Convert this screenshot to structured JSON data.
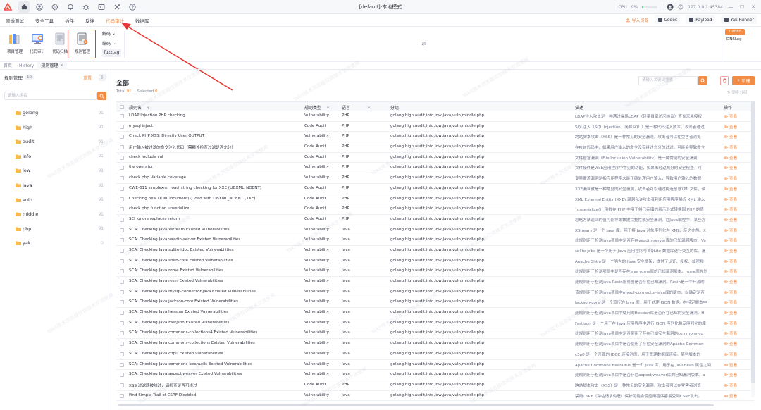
{
  "titlebar": {
    "title": "[default]-本地模式",
    "cpu_label": "CPU",
    "cpu_value": "9%",
    "cpu_fraction": 0.09,
    "engine": "127.0.0.1:45384",
    "icons": [
      "yakit-logo-icon",
      "home-icon",
      "user-icon",
      "gear-icon",
      "bell-icon",
      "bug-icon",
      "terminal-icon",
      "tools-icon",
      "help-icon"
    ]
  },
  "menu": {
    "items": [
      "渗透测试",
      "安全工具",
      "插件",
      "反连",
      "代码审计",
      "数据库"
    ],
    "active_index": 4,
    "import_label": "导入资源",
    "codec_label": "Codec",
    "payload_label": "Payload",
    "runner_label": "Yak Runner"
  },
  "ribbon": {
    "buttons": [
      "项目管理",
      "代码审计",
      "代码扫描",
      "规则管理"
    ],
    "decode_label": "解码",
    "encode_label": "编码",
    "fuzztag_label": "fuzztag",
    "codec_label": "Codec",
    "dnslog_label": "DNSLog"
  },
  "tabs": {
    "items": [
      "首页",
      "History",
      "规则管理"
    ],
    "active_index": 2
  },
  "left": {
    "title": "规则管理",
    "count": "10",
    "reset_label": "重置",
    "search_placeholder": "请输入组名",
    "groups": [
      {
        "name": "golang",
        "count": "91"
      },
      {
        "name": "high",
        "count": "91"
      },
      {
        "name": "audit",
        "count": "91"
      },
      {
        "name": "info",
        "count": "91"
      },
      {
        "name": "low",
        "count": "91"
      },
      {
        "name": "java",
        "count": "91"
      },
      {
        "name": "vuln",
        "count": "91"
      },
      {
        "name": "middle",
        "count": "91"
      },
      {
        "name": "php",
        "count": "91"
      },
      {
        "name": "yak",
        "count": "0"
      }
    ]
  },
  "main": {
    "title": "全部",
    "total_label": "Total",
    "total": "91",
    "selected_label": "Selected",
    "selected": "0",
    "search_placeholder": "请输入关键词搜索",
    "new_label": "新建",
    "sync_label": "同步分组",
    "columns": {
      "name": "规则名",
      "type": "规则类型",
      "lang": "语言",
      "group": "分组",
      "desc": "描述",
      "op": "操作"
    },
    "view_label": "查看",
    "rows": [
      {
        "name": "LDAP Injection PHP checking",
        "type": "Vulnerability",
        "lang": "PHP",
        "group": "golang,high,audit,info,low,java,vuln,middle,php",
        "desc": "LDAP注入攻击是一种通过操纵LDAP（轻量目录访问协议）查询来未授权"
      },
      {
        "name": "mysql inject",
        "type": "Code Audit",
        "lang": "PHP",
        "group": "golang,high,audit,info,low,java,vuln,middle,php",
        "desc": "SQL注入（SQL Injection，简称SQLI）是一种代码注入技术，攻击者通过"
      },
      {
        "name": "Check PHP XSS: Directly User OUTPUT",
        "type": "Vulnerability",
        "lang": "PHP",
        "group": "golang,high,audit,info,low,java,vuln,middle,php",
        "desc": "跨站脚本攻击（XSS）是一种常见的安全漏洞，攻击者可以在受害者浏览"
      },
      {
        "name": "用户输入被过滤的命令注入代码（需额外检查过滤是否充分）",
        "type": "Code Audit",
        "lang": "PHP",
        "group": "golang,high,audit,info,low,java,vuln,middle,php",
        "desc": "在PHP代码中，如果用户输入的命令没有经过充分的过滤，可能会导致命令"
      },
      {
        "name": "check include vul",
        "type": "Code Audit",
        "lang": "PHP",
        "group": "golang,high,audit,info,low,java,vuln,middle,php",
        "desc": "文件包含漏洞（File Inclusion Vulnerability）是一种常见的安全漏洞"
      },
      {
        "name": "file operator",
        "type": "Vulnerability",
        "lang": "PHP",
        "group": "golang,high,audit,info,low,java,vuln,middle,php",
        "desc": "文件操作是Web应用程序中常见的功能，如果未经过充分的安全检查，可"
      },
      {
        "name": "check php Variable coverage",
        "type": "Vulnerability",
        "lang": "PHP",
        "group": "golang,high,audit,info,low,java,vuln,middle,php",
        "desc": "变量覆盖漏洞是指应用程序未能正确处理用户输入，导致用户输入的数据"
      },
      {
        "name": "CWE-611 simplexml_load_string checking for XXE (LIBXML_NOENT)",
        "type": "Code Audit",
        "lang": "PHP",
        "group": "golang,high,audit,info,low,java,vuln,middle,php",
        "desc": "XXE漏洞就是一种常见的安全漏洞，攻击者可以通过构造恶意XML文件，读"
      },
      {
        "name": "Checking new DOMDocument()).load with LIBXML_NOENT (XXE)",
        "type": "Code Audit",
        "lang": "PHP",
        "group": "golang,high,audit,info,low,java,vuln,middle,php",
        "desc": "XML External Entity (XXE) 漏洞允许攻击者利用应用程序解析 XML 输入"
      },
      {
        "name": "check php function unserialize",
        "type": "Code Audit",
        "lang": "PHP",
        "group": "golang,high,audit,info,low,java,vuln,middle,php",
        "desc": "`unserialize()` 函数在 PHP 中用于将已存储的表示形式转换回 PHP 的值"
      },
      {
        "name": "SEI ignore replaces return",
        "type": "Code Audit",
        "lang": "PHP",
        "group": "golang,high,audit,info,low,java,vuln,middle,php",
        "desc": "忽略方法返回的值可能导致数据完整性或安全漏洞。在Java编程中，某些方"
      },
      {
        "name": "SCA: Checking Java xstream Existed Vulnerabilities",
        "type": "Vulnerability",
        "lang": "Java",
        "group": "golang,high,audit,info,low,java,vuln,middle,php",
        "desc": "XStream 是一个 Java 库，用于将 Java 对象序列化为 XML，反之亦然。X"
      },
      {
        "name": "SCA: Checking Java vaadin-server Existed Vulnerabilities",
        "type": "Vulnerability",
        "lang": "Java",
        "group": "golang,high,audit,info,low,java,vuln,middle,php",
        "desc": "此规则用于检测Java项目中是否存在vaadin-server库的已知漏洞版本，Va"
      },
      {
        "name": "SCA: Checking Java sqlite-jdbc Existed Vulnerabilities",
        "type": "Vulnerability",
        "lang": "Java",
        "group": "golang,high,audit,info,low,java,vuln,middle,php",
        "desc": "sqlite-jdbc 是一个用于 Java 应用程序与 SQLite 数据库进行交互的库。漏"
      },
      {
        "name": "SCA: Checking Java shiro-core Existed Vulnerabilities",
        "type": "Vulnerability",
        "lang": "Java",
        "group": "golang,high,audit,info,low,java,vuln,middle,php",
        "desc": "Apache Shiro 是一个强大的 Java 安全框架，提供了认证、授权、加密和"
      },
      {
        "name": "SCA: Checking Java rome Existed Vulnerabilities",
        "type": "Vulnerability",
        "lang": "Java",
        "group": "golang,high,audit,info,low,java,vuln,middle,php",
        "desc": "此规则用于检测项目中是否存在Java rome库的已知漏洞版本。rome库在处"
      },
      {
        "name": "SCA: Checking Java resin Existed Vulnerabilities",
        "type": "Vulnerability",
        "lang": "Java",
        "group": "golang,high,audit,info,low,java,vuln,middle,php",
        "desc": "此规则用于检测Java Resin服务器是否存在已知漏洞。Resin是一个开源的"
      },
      {
        "name": "SCA: Checking Java mysql-connector-java Existed Vulnerabilities",
        "type": "Vulnerability",
        "lang": "Java",
        "group": "golang,high,audit,info,low,java,vuln,middle,php",
        "desc": "该规则用于检测Java项目中mysql-connector-java库的版本，以确定是否"
      },
      {
        "name": "SCA: Checking Java jackson-core Existed Vulnerabilities",
        "type": "Vulnerability",
        "lang": "Java",
        "group": "golang,high,audit,info,low,java,vuln,middle,php",
        "desc": "Jackson-core 是一个流行的 Java 库，用于处理 JSON 数据。在特定版本中"
      },
      {
        "name": "SCA: Checking Java hessian Existed Vulnerabilities",
        "type": "Vulnerability",
        "lang": "Java",
        "group": "golang,high,audit,info,low,java,vuln,middle,php",
        "desc": "此规则用于检测Java项目中使用的Hessian库是否存在已知的安全漏洞。H"
      },
      {
        "name": "SCA: Checking Java Fastjson Existed Vulnerabilities",
        "type": "Vulnerability",
        "lang": "Java",
        "group": "golang,high,audit,info,low,java,vuln,middle,php",
        "desc": "Fastjson 是一个用于在 Java 应用程序中进行 JSON 序列化和反序列化的库"
      },
      {
        "name": "SCA: Checking Java commons-collections4 Existed Vulnerabilities",
        "type": "Vulnerability",
        "lang": "Java",
        "group": "golang,high,audit,info,low,java,vuln,middle,php",
        "desc": "此规则用于检测Java项目中是否使用了存在已知安全漏洞的commons-co"
      },
      {
        "name": "SCA: Checking Java commons-collections Existed Vulnerabilities",
        "type": "Vulnerability",
        "lang": "Java",
        "group": "golang,high,audit,info,low,java,vuln,middle,php",
        "desc": "此规则用于检测Java项目中是否使用了存在安全漏洞的Apache Common"
      },
      {
        "name": "SCA: Checking Java c3p0 Existed Vulnerabilities",
        "type": "Vulnerability",
        "lang": "Java",
        "group": "golang,high,audit,info,low,java,vuln,middle,php",
        "desc": "c3p0 是一个开源的 JDBC 连接池库，用于管理数据库连接。某些版本的"
      },
      {
        "name": "SCA: Checking Java commons-beanutils Existed Vulnerabilities",
        "type": "Vulnerability",
        "lang": "Java",
        "group": "golang,high,audit,info,low,java,vuln,middle,php",
        "desc": "Apache Commons BeanUtils 是一个 Java 库，用于在 JavaBean 属性之间"
      },
      {
        "name": "SCA: Checking Java aspectjweaver Existed Vulnerabilities",
        "type": "Vulnerability",
        "lang": "Java",
        "group": "golang,high,audit,info,low,java,vuln,middle,php",
        "desc": "此规则用于检测Java项目中是否存在aspectjweaver库的已知漏洞版本。a"
      },
      {
        "name": "XSS 过滤器被绕过，请检查是否可绕过",
        "type": "Code Audit",
        "lang": "PHP",
        "group": "golang,high,audit,info,low,java,vuln,middle,php",
        "desc": "跨站脚本攻击（XSS）是一种常见的安全漏洞，攻击者可以在受害者浏览"
      },
      {
        "name": "Find Simple Trail of CSRF Disabled",
        "type": "Vulnerability",
        "lang": "Java",
        "group": "golang,high,audit,info,low,java,vuln,middle,php",
        "desc": "禁用CSRF（跨站请求伪造）保护可能会使应用程序容易受到CSRF攻击。"
      }
    ]
  },
  "watermark": "Yakit技术浏览版仅供技术交流使用",
  "colors": {
    "accent": "#f28b44",
    "highlight": "#e53935",
    "text": "#31343f",
    "muted": "#85899e",
    "folder": "#f6b94b"
  }
}
